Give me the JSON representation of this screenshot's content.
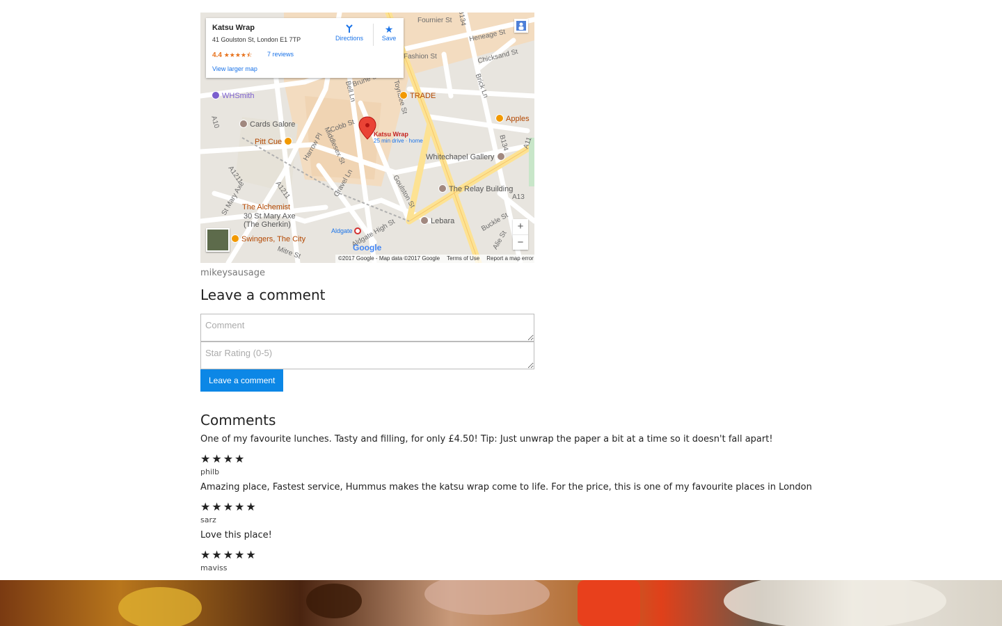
{
  "map": {
    "place_name": "Katsu Wrap",
    "address": "41 Goulston St, London E1 7TP",
    "rating": "4.4",
    "stars": "★★★★⯪",
    "reviews": "7 reviews",
    "larger_map": "View larger map",
    "directions": "Directions",
    "save": "Save",
    "marker_label": "Katsu Wrap",
    "marker_sub": "25 min drive · home",
    "streets": [
      "Fournier St",
      "B134",
      "Heneage St",
      "Fashion St",
      "Chicksand St",
      "Brick Ln",
      "Bell Ln",
      "Toynbee St",
      "Brune St",
      "Cobb St",
      "Middlesex St",
      "Harrow Pl",
      "Gravel Ln",
      "Goulston St",
      "A10",
      "A1211",
      "A1211",
      "St Mary Axe",
      "Mitre St",
      "Aldgate High St",
      "Buckle St",
      "Alie St",
      "A13",
      "A11",
      "B134"
    ],
    "pois": [
      "WHSmith",
      "Cards Galore",
      "Pitt Cue",
      "TRADE",
      "Apples",
      "Whitechapel Gallery",
      "The Relay Building",
      "The Alchemist",
      "30 St Mary Axe",
      "(The Gherkin)",
      "Swingers, The City",
      "Lebara",
      "Aldgate"
    ],
    "google": "Google",
    "attribution": "©2017 Google - Map data ©2017 Google",
    "terms": "Terms of Use",
    "report": "Report a map error",
    "zoom_in": "+",
    "zoom_out": "−"
  },
  "author": "mikeysausage",
  "leave_comment": {
    "title": "Leave a comment",
    "comment_placeholder": "Comment",
    "rating_placeholder": "Star Rating (0-5)",
    "button": "Leave a comment"
  },
  "comments": {
    "title": "Comments",
    "items": [
      {
        "text": "One of my favourite lunches. Tasty and filling, for only £4.50! Tip: Just unwrap the paper a bit at a time so it doesn't fall apart!",
        "stars": "★★★★",
        "rating": 4,
        "user": "philb"
      },
      {
        "text": "Amazing place, Fastest service, Hummus makes the katsu wrap come to life. For the price, this is one of my favourite places in London",
        "stars": "★★★★★",
        "rating": 5,
        "user": "sarz"
      },
      {
        "text": "Love this place!",
        "stars": "★★★★★",
        "rating": 5,
        "user": "maviss"
      }
    ]
  }
}
